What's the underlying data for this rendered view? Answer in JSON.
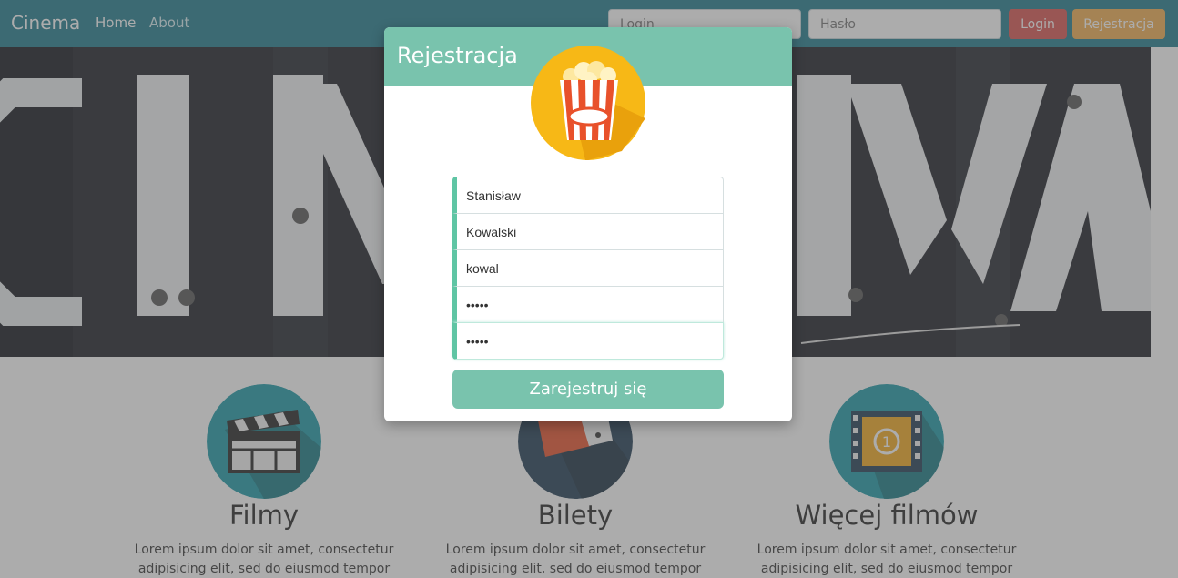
{
  "navbar": {
    "brand": "Cinema",
    "links": [
      "Home",
      "About"
    ],
    "login_placeholder": "Login",
    "password_placeholder": "Hasło",
    "login_button": "Login",
    "register_button": "Rejestracja"
  },
  "hero": {
    "image_text": "CINEMA"
  },
  "features": [
    {
      "title": "Filmy",
      "text": "Lorem ipsum dolor sit amet, consectetur adipisicing elit, sed do eiusmod tempor",
      "icon": "clapperboard-icon"
    },
    {
      "title": "Bilety",
      "text": "Lorem ipsum dolor sit amet, consectetur adipisicing elit, sed do eiusmod tempor",
      "icon": "ticket-icon"
    },
    {
      "title": "Więcej filmów",
      "text": "Lorem ipsum dolor sit amet, consectetur adipisicing elit, sed do eiusmod tempor",
      "icon": "film-reel-icon"
    }
  ],
  "modal": {
    "title": "Rejestracja",
    "icon": "popcorn-icon",
    "fields": {
      "first_name": "Stanisław",
      "last_name": "Kowalski",
      "login": "kowal",
      "password": "•••••",
      "password_confirm": "•••••"
    },
    "submit_label": "Zarejestruj się"
  },
  "colors": {
    "navbar": "#1f7b8d",
    "modal_accent": "#79c3ad",
    "field_accent": "#5fc5a4",
    "login_button": "#d9534f",
    "register_button": "#f0ad4e"
  }
}
